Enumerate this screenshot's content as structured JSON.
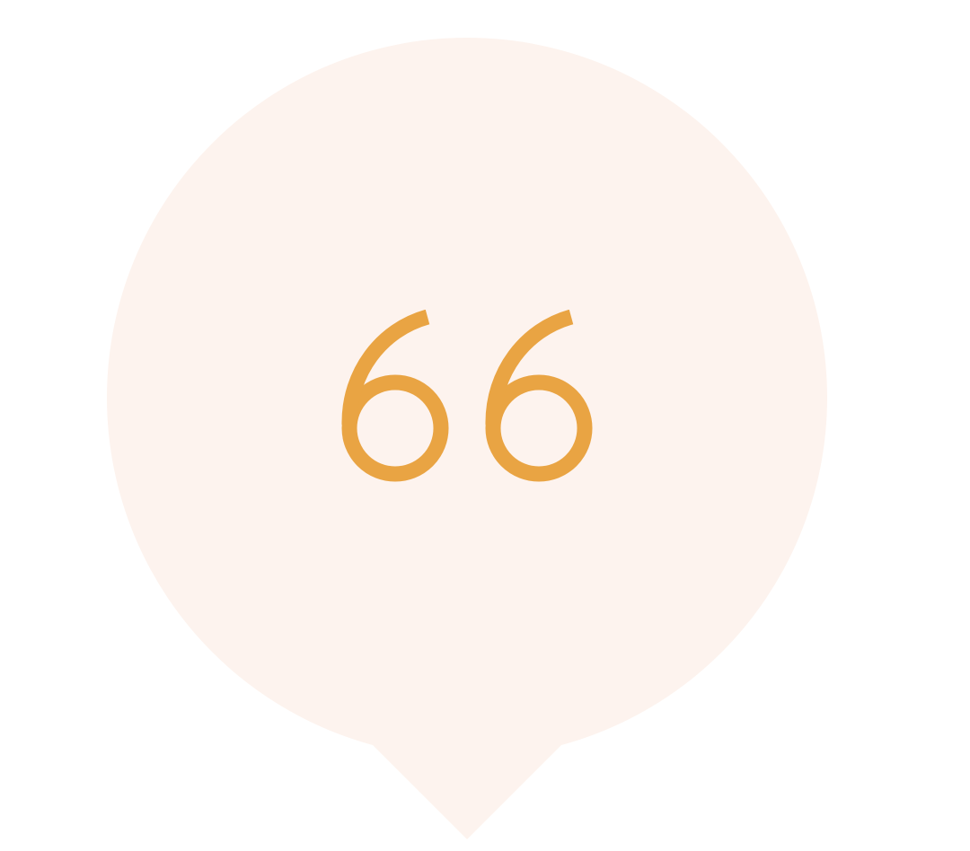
{
  "icon": {
    "name": "quote-bubble-icon",
    "quote_mark": "66"
  },
  "colors": {
    "background": "#ffffff",
    "bubble_fill": "#fdf3ee",
    "quote_color": "#e9a443"
  }
}
